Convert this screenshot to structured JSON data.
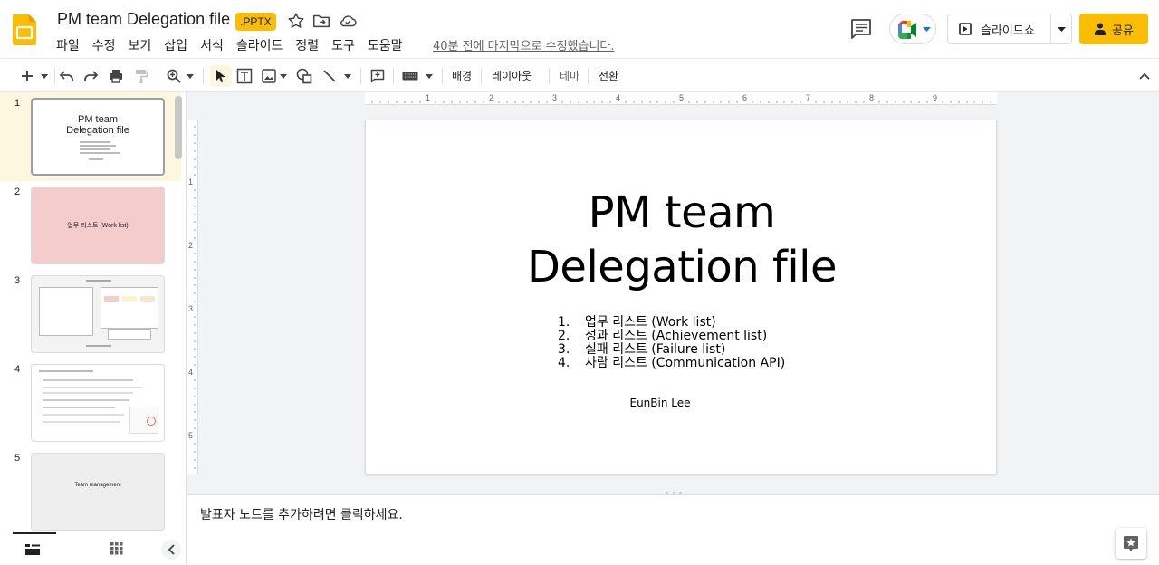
{
  "header": {
    "title": "PM team Delegation file",
    "badge": ".PPTX",
    "last_edit": "40분 전에 마지막으로 수정했습니다.",
    "menu": [
      "파일",
      "수정",
      "보기",
      "삽입",
      "서식",
      "슬라이드",
      "정렬",
      "도구",
      "도움말"
    ],
    "slideshow_label": "슬라이드쇼",
    "share_label": "공유",
    "colors": {
      "brand_yellow": "#fbbc04",
      "meet_green": "#00832d"
    }
  },
  "toolbar": {
    "background_label": "배경",
    "layout_label": "레이아웃",
    "theme_label": "테마",
    "transition_label": "전환"
  },
  "filmstrip": {
    "slides": [
      {
        "num": "1",
        "title_l1": "PM team",
        "title_l2": "Delegation file",
        "active": true
      },
      {
        "num": "2",
        "title": "업무 리스트 (Work list)",
        "bg": "#f4cccc"
      },
      {
        "num": "3"
      },
      {
        "num": "4"
      },
      {
        "num": "5",
        "title": "Team management",
        "bg": "#eeeeee"
      }
    ]
  },
  "ruler": {
    "h": [
      "1",
      "2",
      "3",
      "4",
      "5",
      "6",
      "7",
      "8",
      "9"
    ],
    "v": [
      "1",
      "2",
      "3",
      "4",
      "5"
    ]
  },
  "slide": {
    "title_l1": "PM team",
    "title_l2": "Delegation file",
    "list": [
      {
        "n": "1.",
        "text": "업무 리스트 (Work list)"
      },
      {
        "n": "2.",
        "text": "성과 리스트 (Achievement list)"
      },
      {
        "n": "3.",
        "text": "실패 리스트 (Failure list)"
      },
      {
        "n": "4.",
        "text": "사람 리스트 (Communication API)"
      }
    ],
    "author": "EunBin Lee"
  },
  "notes": {
    "placeholder": "발표자 노트를 추가하려면 클릭하세요."
  }
}
